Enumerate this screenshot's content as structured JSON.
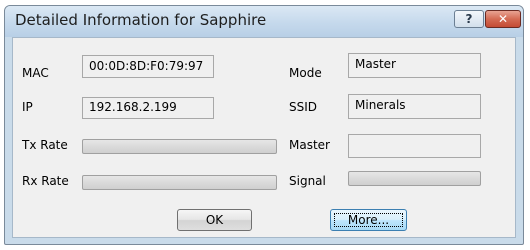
{
  "window": {
    "title": "Detailed Information for Sapphire",
    "help_glyph": "?",
    "close_glyph": "✕"
  },
  "fields": {
    "mac": {
      "label": "MAC",
      "value": "00:0D:8D:F0:79:97"
    },
    "ip": {
      "label": "IP",
      "value": "192.168.2.199"
    },
    "tx_rate": {
      "label": "Tx Rate",
      "level": 0
    },
    "rx_rate": {
      "label": "Rx Rate",
      "level": 0
    },
    "mode": {
      "label": "Mode",
      "value": "Master"
    },
    "ssid": {
      "label": "SSID",
      "value": "Minerals"
    },
    "master": {
      "label": "Master",
      "value": ""
    },
    "signal": {
      "label": "Signal",
      "level": 0
    }
  },
  "buttons": {
    "ok": "OK",
    "more": "More..."
  }
}
